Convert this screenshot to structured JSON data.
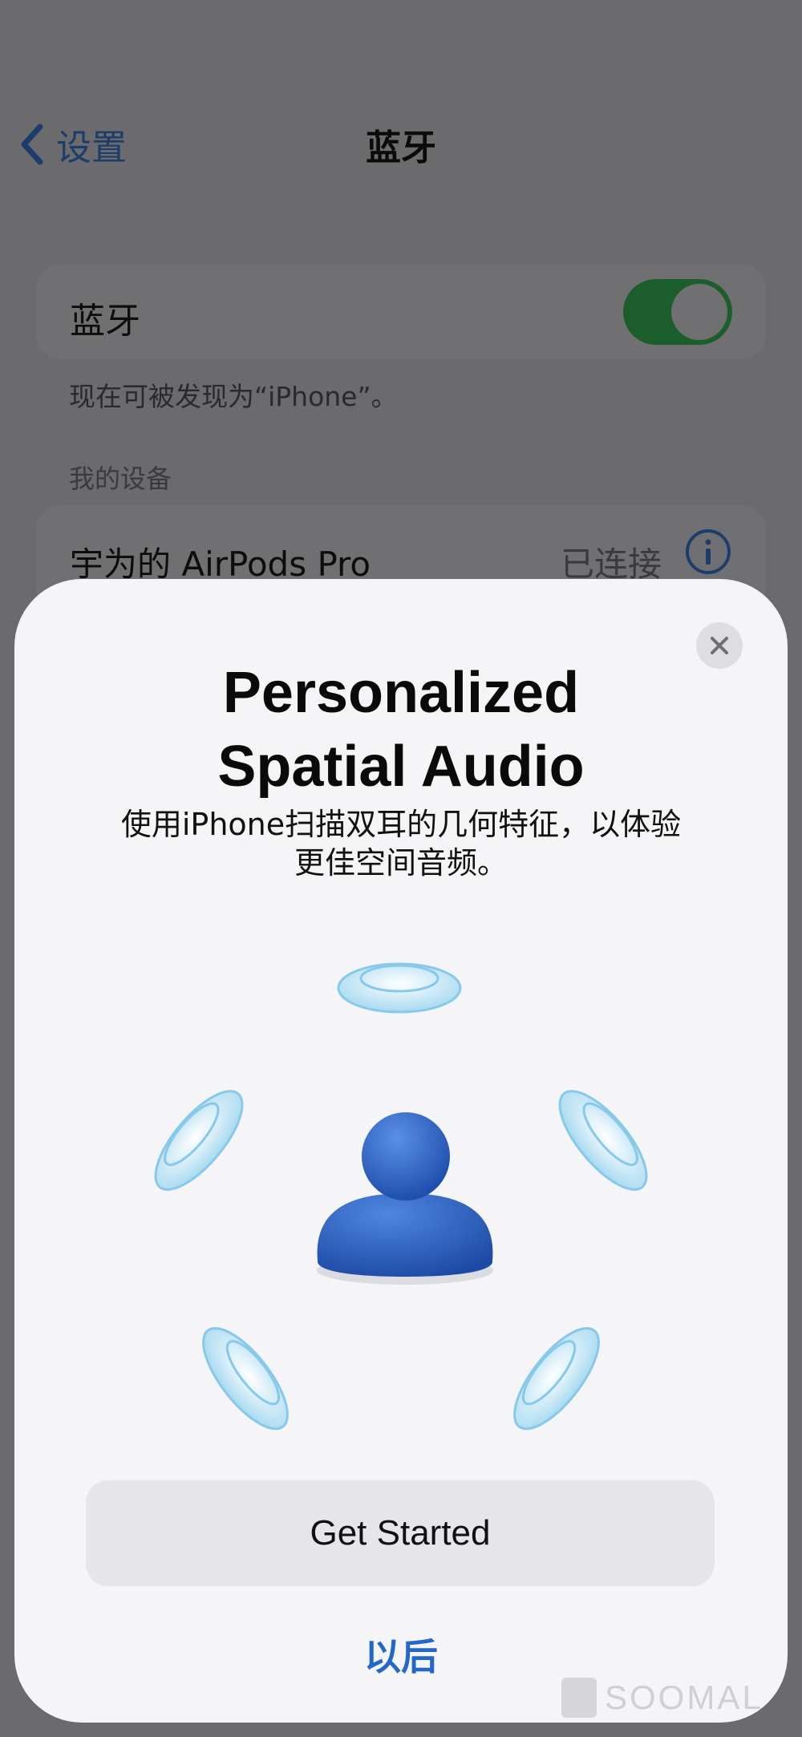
{
  "nav": {
    "back_label": "设置",
    "title": "蓝牙"
  },
  "bluetooth": {
    "label": "蓝牙",
    "enabled": true,
    "discoverable_text": "现在可被发现为“iPhone”。"
  },
  "devices": {
    "section_header": "我的设备",
    "items": [
      {
        "name": "宇为的 AirPods Pro",
        "status": "已连接"
      }
    ]
  },
  "sheet": {
    "title_line1": "Personalized",
    "title_line2": "Spatial Audio",
    "subtitle_line1": "使用iPhone扫描双耳的几何特征，以体验",
    "subtitle_line2": "更佳空间音频。",
    "primary_button": "Get Started",
    "secondary_link": "以后"
  },
  "watermark": "SOOMAL",
  "colors": {
    "accent": "#2367c9",
    "toggle_on": "#1b5e2c",
    "sheet_bg": "#f5f5f7",
    "figure_blue": "#2a63c8",
    "speaker_blue": "#9fd6ef"
  },
  "icons": [
    "chevron-left-icon",
    "info-icon",
    "close-icon",
    "person-icon",
    "speaker-icon"
  ]
}
